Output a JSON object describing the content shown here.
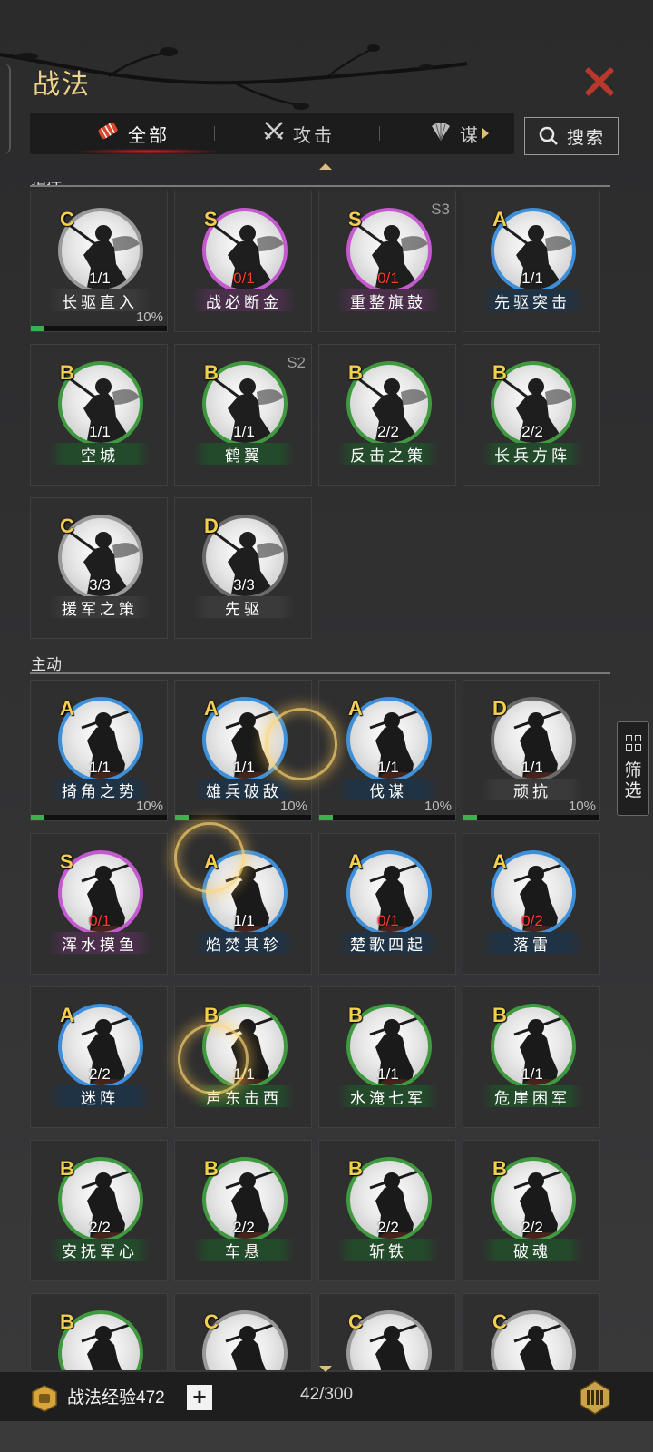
{
  "window": {
    "title": "战法"
  },
  "tabs": [
    {
      "label": "全部",
      "icon": "scroll-icon",
      "active": true
    },
    {
      "label": "攻击",
      "icon": "crossed-swords-icon",
      "active": false
    },
    {
      "label": "谋",
      "icon": "fan-icon",
      "active": false
    }
  ],
  "search": {
    "label": "搜索"
  },
  "filter": {
    "line1": "筛",
    "line2": "选"
  },
  "sections": {
    "command": "指挥",
    "active": "主动"
  },
  "colors": {
    "S": "#c55ad0",
    "A": "#3c8fd8",
    "B": "#3f9a3f",
    "C": "#9a9a9a",
    "D": "#6a6a6a",
    "plate_S": "#4a2f4a",
    "plate_A": "#203345",
    "plate_B": "#234a2a",
    "plate_C": "#3a3a3a",
    "plate_D": "#3a3a3a",
    "title": "#f0d38a",
    "close": "#b8392b",
    "progress": "#39b24d",
    "zero_count": "#ff3b30"
  },
  "command_cards": [
    {
      "grade": "C",
      "count": "1/1",
      "name": "长驱直入",
      "progress_pct": 10,
      "progress_label": "10%"
    },
    {
      "grade": "S",
      "count": "0/1",
      "name": "战必断金",
      "zero": true
    },
    {
      "grade": "S",
      "count": "0/1",
      "name": "重整旗鼓",
      "zero": true,
      "season": "S3"
    },
    {
      "grade": "A",
      "count": "1/1",
      "name": "先驱突击"
    },
    {
      "grade": "B",
      "count": "1/1",
      "name": "空城"
    },
    {
      "grade": "B",
      "count": "1/1",
      "name": "鹤翼",
      "season": "S2"
    },
    {
      "grade": "B",
      "count": "2/2",
      "name": "反击之策"
    },
    {
      "grade": "B",
      "count": "2/2",
      "name": "长兵方阵"
    },
    {
      "grade": "C",
      "count": "3/3",
      "name": "援军之策"
    },
    {
      "grade": "D",
      "count": "3/3",
      "name": "先驱"
    }
  ],
  "active_cards": [
    {
      "grade": "A",
      "count": "1/1",
      "name": "掎角之势",
      "progress_pct": 10,
      "progress_label": "10%"
    },
    {
      "grade": "A",
      "count": "1/1",
      "name": "雄兵破敌",
      "progress_pct": 10,
      "progress_label": "10%"
    },
    {
      "grade": "A",
      "count": "1/1",
      "name": "伐谋",
      "progress_pct": 10,
      "progress_label": "10%"
    },
    {
      "grade": "D",
      "count": "1/1",
      "name": "顽抗",
      "progress_pct": 10,
      "progress_label": "10%"
    },
    {
      "grade": "S",
      "count": "0/1",
      "name": "浑水摸鱼",
      "zero": true
    },
    {
      "grade": "A",
      "count": "1/1",
      "name": "焰焚其轸"
    },
    {
      "grade": "A",
      "count": "0/1",
      "name": "楚歌四起",
      "zero": true
    },
    {
      "grade": "A",
      "count": "0/2",
      "name": "落雷",
      "zero": true
    },
    {
      "grade": "A",
      "count": "2/2",
      "name": "迷阵"
    },
    {
      "grade": "B",
      "count": "1/1",
      "name": "声东击西"
    },
    {
      "grade": "B",
      "count": "1/1",
      "name": "水淹七军"
    },
    {
      "grade": "B",
      "count": "1/1",
      "name": "危崖困军"
    },
    {
      "grade": "B",
      "count": "2/2",
      "name": "安抚军心"
    },
    {
      "grade": "B",
      "count": "2/2",
      "name": "车悬"
    },
    {
      "grade": "B",
      "count": "2/2",
      "name": "斩铁"
    },
    {
      "grade": "B",
      "count": "2/2",
      "name": "破魂"
    },
    {
      "grade": "B",
      "count": "",
      "name": ""
    },
    {
      "grade": "C",
      "count": "",
      "name": ""
    },
    {
      "grade": "C",
      "count": "",
      "name": ""
    },
    {
      "grade": "C",
      "count": "",
      "name": ""
    }
  ],
  "bottom": {
    "exp_label": "战法经验472",
    "plus": "+",
    "capacity": "42/300"
  }
}
